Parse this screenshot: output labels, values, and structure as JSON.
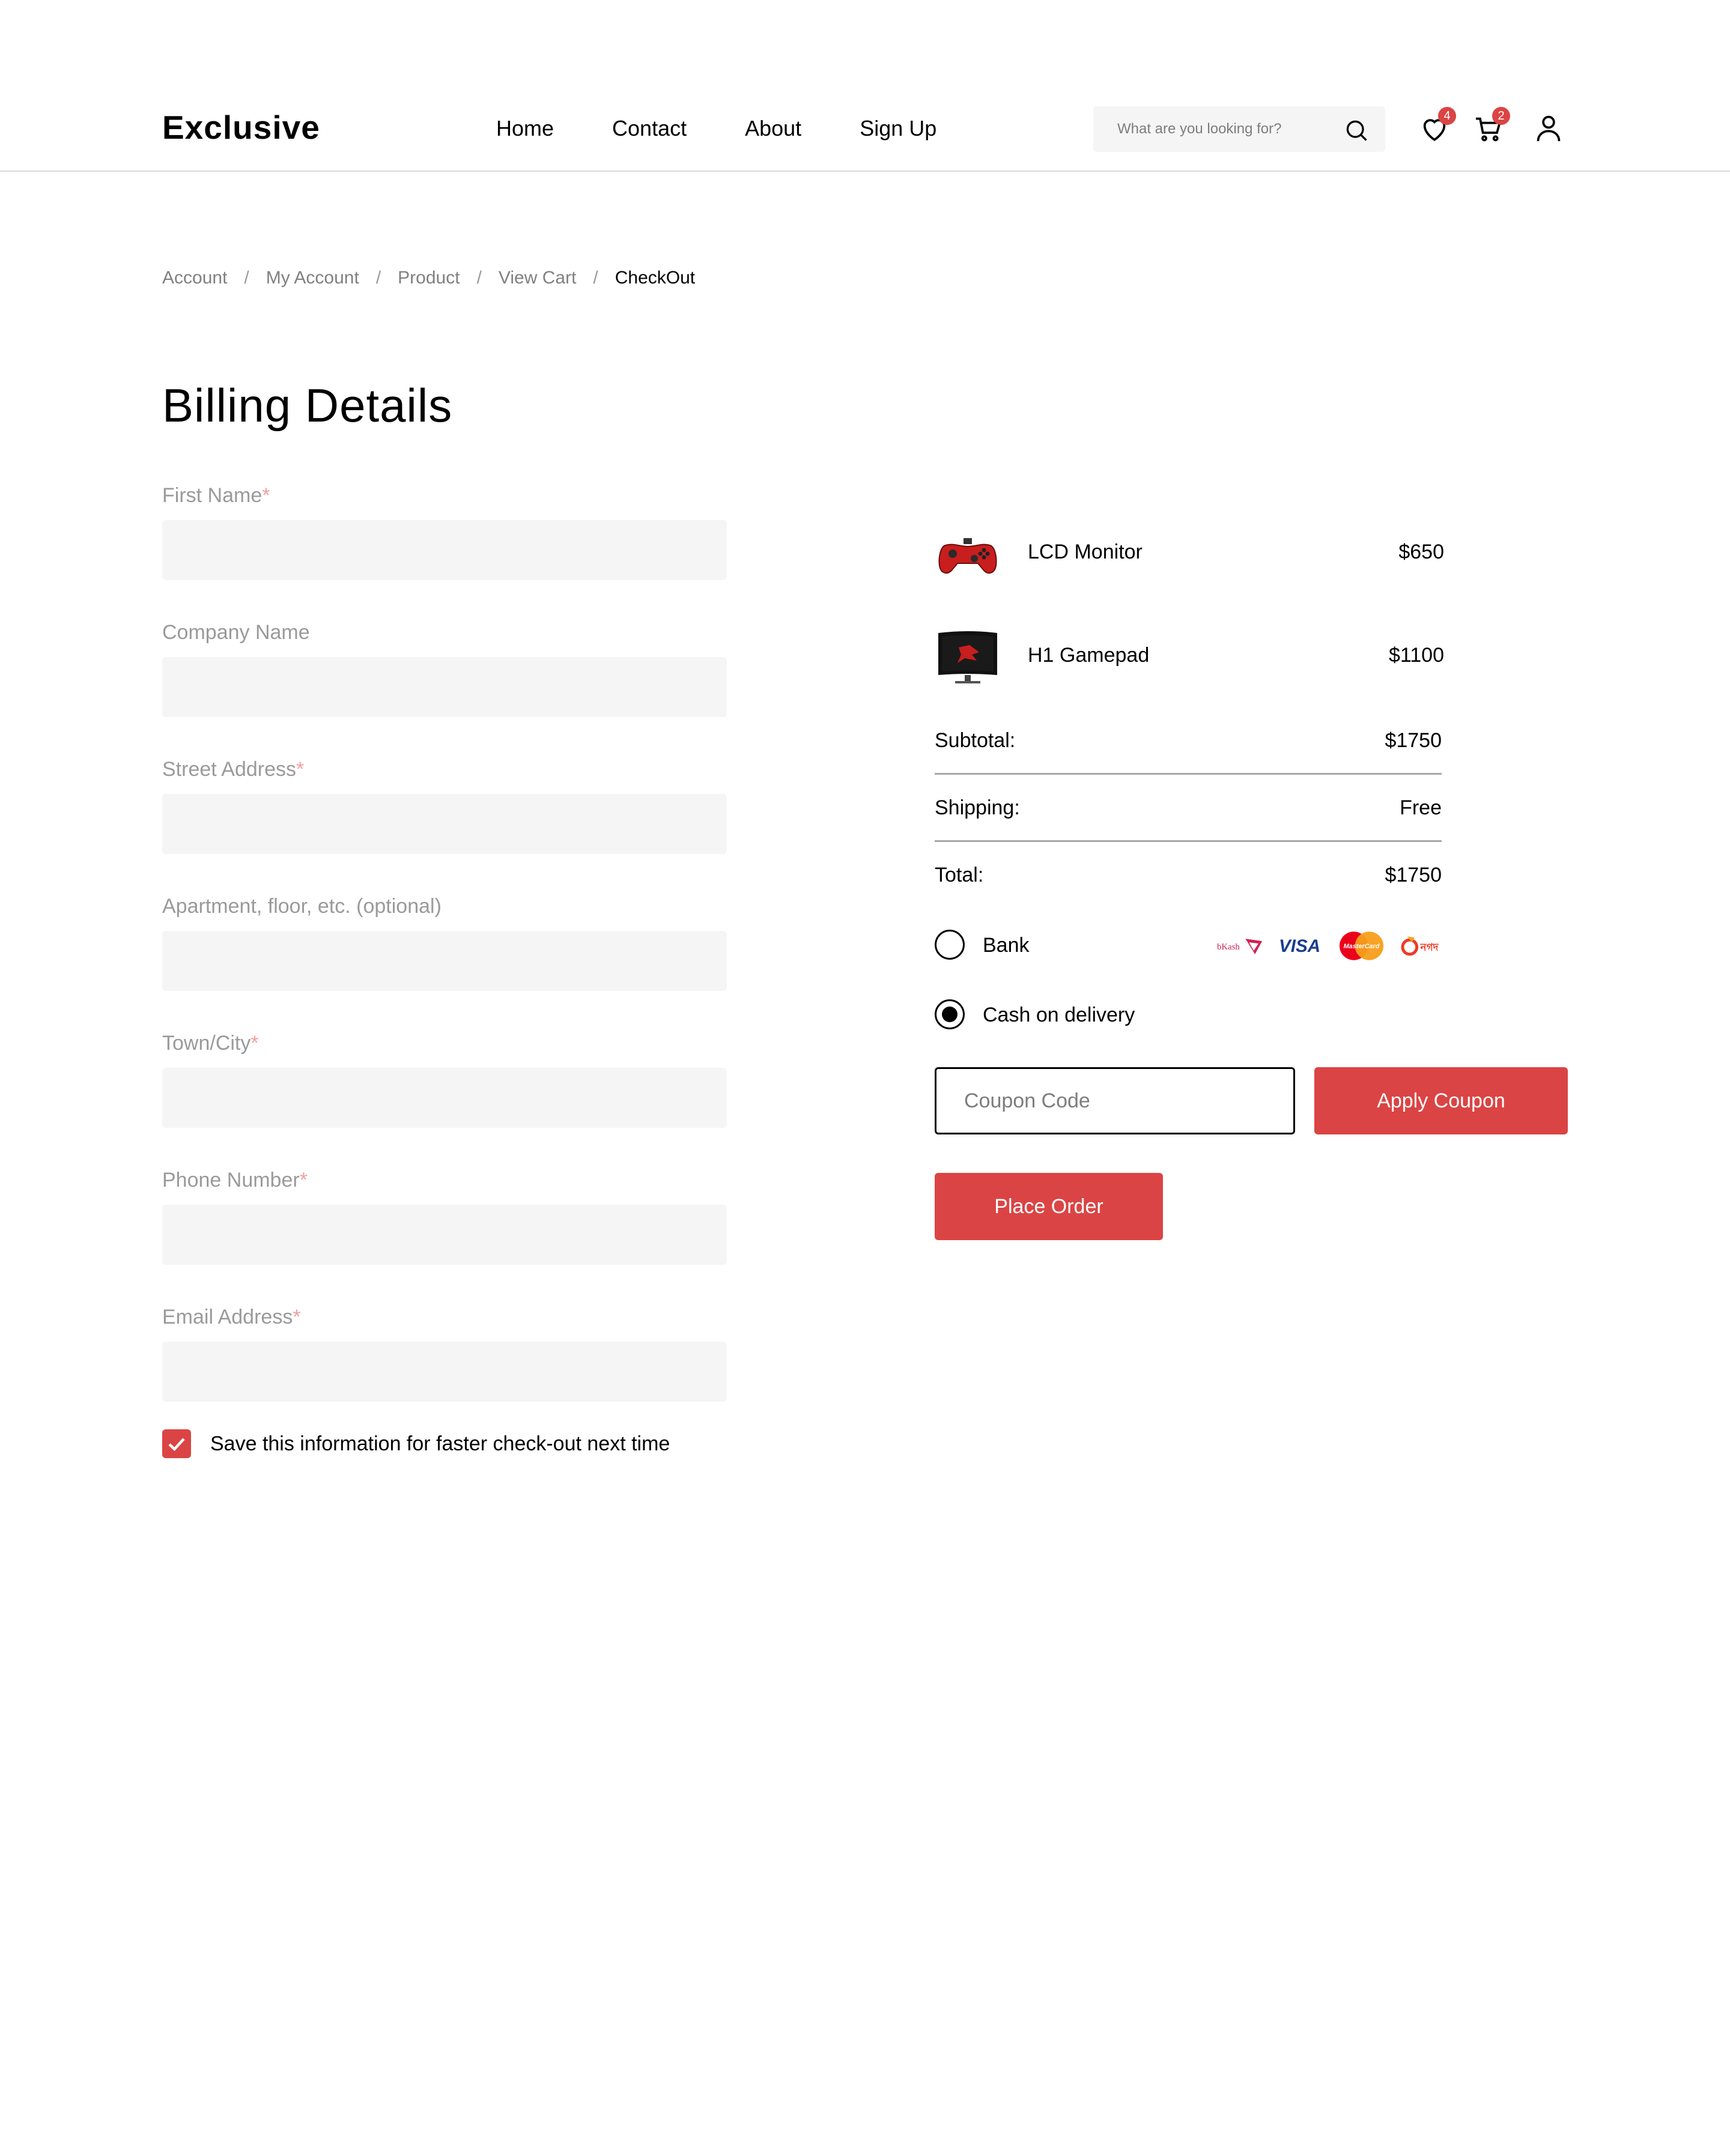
{
  "header": {
    "logo": "Exclusive",
    "nav": [
      "Home",
      "Contact",
      "About",
      "Sign Up"
    ],
    "search_placeholder": "What are you looking for?",
    "wishlist_count": "4",
    "cart_count": "2"
  },
  "breadcrumb": {
    "items": [
      "Account",
      "My Account",
      "Product",
      "View Cart"
    ],
    "current": "CheckOut",
    "separator": "/"
  },
  "billing": {
    "title": "Billing Details",
    "fields": [
      {
        "label": "First Name",
        "required": "*",
        "value": ""
      },
      {
        "label": "Company Name",
        "required": "",
        "value": ""
      },
      {
        "label": "Street Address",
        "required": "*",
        "value": ""
      },
      {
        "label": "Apartment, floor, etc. (optional)",
        "required": "",
        "value": ""
      },
      {
        "label": "Town/City",
        "required": "*",
        "value": ""
      },
      {
        "label": "Phone Number",
        "required": "*",
        "value": ""
      },
      {
        "label": "Email Address",
        "required": "*",
        "value": ""
      }
    ],
    "save_info_label": "Save this information for faster check-out next time",
    "save_info_checked": true
  },
  "order": {
    "items": [
      {
        "name": "LCD Monitor",
        "price": "$650",
        "icon": "gamepad-icon"
      },
      {
        "name": "H1 Gamepad",
        "price": "$1100",
        "icon": "monitor-icon"
      }
    ],
    "subtotal_label": "Subtotal:",
    "subtotal": "$1750",
    "shipping_label": "Shipping:",
    "shipping": "Free",
    "total_label": "Total:",
    "total": "$1750",
    "payment": {
      "bank_label": "Bank",
      "cod_label": "Cash on delivery",
      "selected": "cod",
      "logos": [
        "bKash",
        "VISA",
        "MasterCard",
        "নগদ"
      ]
    },
    "coupon_placeholder": "Coupon Code",
    "apply_coupon_label": "Apply Coupon",
    "place_order_label": "Place Order"
  },
  "colors": {
    "accent": "#DB4444",
    "input_bg": "#F5F5F5",
    "muted_text": "#808080"
  }
}
